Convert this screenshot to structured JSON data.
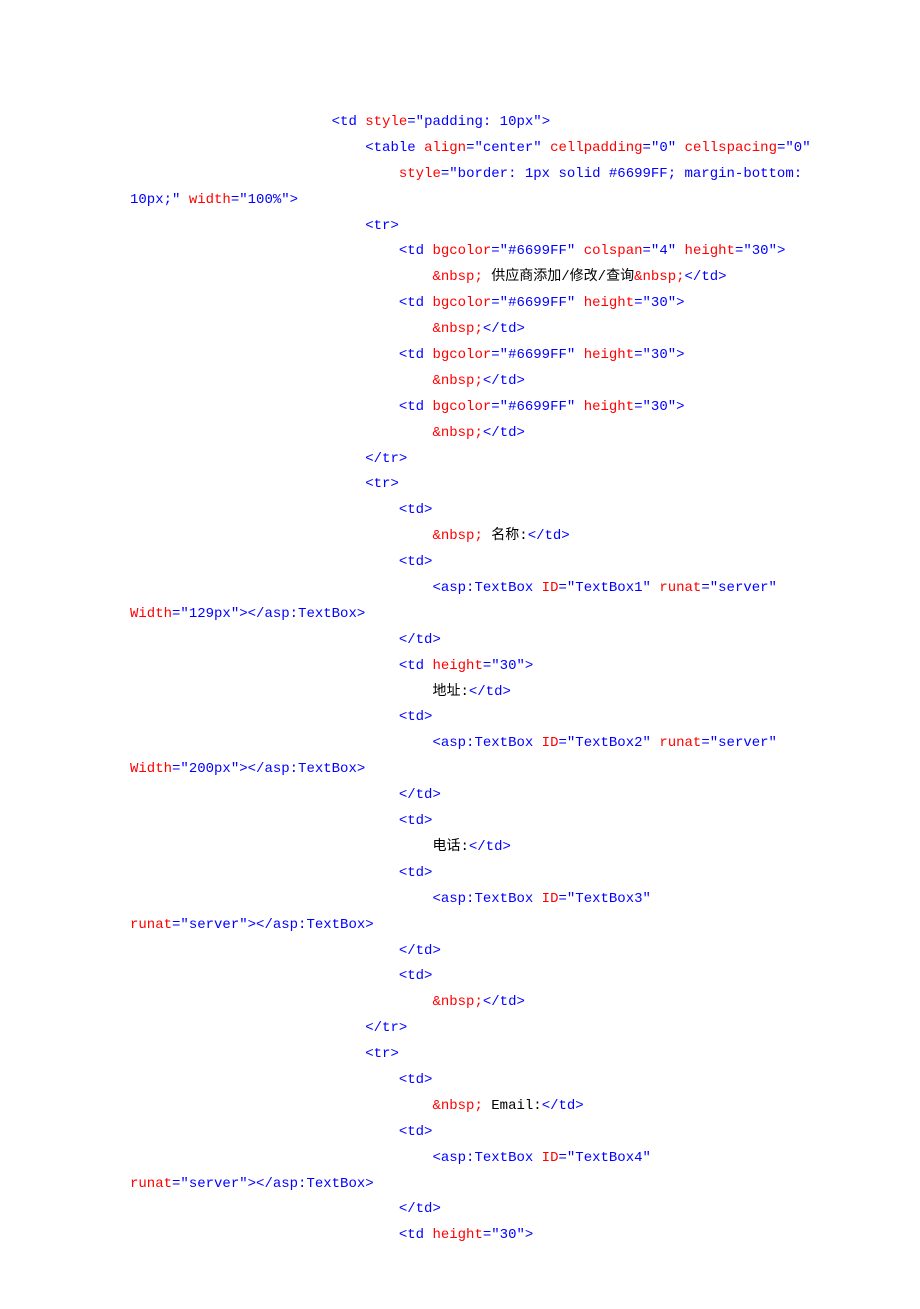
{
  "lines": [
    {
      "indent": 24,
      "parts": [
        {
          "c": "tag",
          "t": "<td "
        },
        {
          "c": "attr",
          "t": "style"
        },
        {
          "c": "tag",
          "t": "="
        },
        {
          "c": "str",
          "t": "\"padding: 10px\""
        },
        {
          "c": "tag",
          "t": ">"
        }
      ]
    },
    {
      "indent": 28,
      "parts": [
        {
          "c": "tag",
          "t": "<table "
        },
        {
          "c": "attr",
          "t": "align"
        },
        {
          "c": "tag",
          "t": "="
        },
        {
          "c": "str",
          "t": "\"center\""
        },
        {
          "c": "txt",
          "t": " "
        },
        {
          "c": "attr",
          "t": "cellpadding"
        },
        {
          "c": "tag",
          "t": "="
        },
        {
          "c": "str",
          "t": "\"0\""
        },
        {
          "c": "txt",
          "t": " "
        },
        {
          "c": "attr",
          "t": "cellspacing"
        },
        {
          "c": "tag",
          "t": "="
        },
        {
          "c": "str",
          "t": "\"0\""
        }
      ]
    },
    {
      "indent": 32,
      "parts": [
        {
          "c": "attr",
          "t": "style"
        },
        {
          "c": "tag",
          "t": "="
        },
        {
          "c": "str",
          "t": "\"border: 1px solid #6699FF; margin-bottom: "
        }
      ]
    },
    {
      "indent": 0,
      "parts": [
        {
          "c": "str",
          "t": "10px;\""
        },
        {
          "c": "txt",
          "t": " "
        },
        {
          "c": "attr",
          "t": "width"
        },
        {
          "c": "tag",
          "t": "="
        },
        {
          "c": "str",
          "t": "\"100%\""
        },
        {
          "c": "tag",
          "t": ">"
        }
      ]
    },
    {
      "indent": 28,
      "parts": [
        {
          "c": "tag",
          "t": "<tr>"
        }
      ]
    },
    {
      "indent": 32,
      "parts": [
        {
          "c": "tag",
          "t": "<td "
        },
        {
          "c": "attr",
          "t": "bgcolor"
        },
        {
          "c": "tag",
          "t": "="
        },
        {
          "c": "str",
          "t": "\"#6699FF\""
        },
        {
          "c": "txt",
          "t": " "
        },
        {
          "c": "attr",
          "t": "colspan"
        },
        {
          "c": "tag",
          "t": "="
        },
        {
          "c": "str",
          "t": "\"4\""
        },
        {
          "c": "txt",
          "t": " "
        },
        {
          "c": "attr",
          "t": "height"
        },
        {
          "c": "tag",
          "t": "="
        },
        {
          "c": "str",
          "t": "\"30\""
        },
        {
          "c": "tag",
          "t": ">"
        }
      ]
    },
    {
      "indent": 36,
      "parts": [
        {
          "c": "ent",
          "t": "&nbsp;"
        },
        {
          "c": "txt",
          "t": " 供应商添加/修改/查询"
        },
        {
          "c": "ent",
          "t": "&nbsp;"
        },
        {
          "c": "tag",
          "t": "</td>"
        }
      ]
    },
    {
      "indent": 32,
      "parts": [
        {
          "c": "tag",
          "t": "<td "
        },
        {
          "c": "attr",
          "t": "bgcolor"
        },
        {
          "c": "tag",
          "t": "="
        },
        {
          "c": "str",
          "t": "\"#6699FF\""
        },
        {
          "c": "txt",
          "t": " "
        },
        {
          "c": "attr",
          "t": "height"
        },
        {
          "c": "tag",
          "t": "="
        },
        {
          "c": "str",
          "t": "\"30\""
        },
        {
          "c": "tag",
          "t": ">"
        }
      ]
    },
    {
      "indent": 36,
      "parts": [
        {
          "c": "ent",
          "t": "&nbsp;"
        },
        {
          "c": "tag",
          "t": "</td>"
        }
      ]
    },
    {
      "indent": 32,
      "parts": [
        {
          "c": "tag",
          "t": "<td "
        },
        {
          "c": "attr",
          "t": "bgcolor"
        },
        {
          "c": "tag",
          "t": "="
        },
        {
          "c": "str",
          "t": "\"#6699FF\""
        },
        {
          "c": "txt",
          "t": " "
        },
        {
          "c": "attr",
          "t": "height"
        },
        {
          "c": "tag",
          "t": "="
        },
        {
          "c": "str",
          "t": "\"30\""
        },
        {
          "c": "tag",
          "t": ">"
        }
      ]
    },
    {
      "indent": 36,
      "parts": [
        {
          "c": "ent",
          "t": "&nbsp;"
        },
        {
          "c": "tag",
          "t": "</td>"
        }
      ]
    },
    {
      "indent": 32,
      "parts": [
        {
          "c": "tag",
          "t": "<td "
        },
        {
          "c": "attr",
          "t": "bgcolor"
        },
        {
          "c": "tag",
          "t": "="
        },
        {
          "c": "str",
          "t": "\"#6699FF\""
        },
        {
          "c": "txt",
          "t": " "
        },
        {
          "c": "attr",
          "t": "height"
        },
        {
          "c": "tag",
          "t": "="
        },
        {
          "c": "str",
          "t": "\"30\""
        },
        {
          "c": "tag",
          "t": ">"
        }
      ]
    },
    {
      "indent": 36,
      "parts": [
        {
          "c": "ent",
          "t": "&nbsp;"
        },
        {
          "c": "tag",
          "t": "</td>"
        }
      ]
    },
    {
      "indent": 28,
      "parts": [
        {
          "c": "tag",
          "t": "</tr>"
        }
      ]
    },
    {
      "indent": 28,
      "parts": [
        {
          "c": "tag",
          "t": "<tr>"
        }
      ]
    },
    {
      "indent": 32,
      "parts": [
        {
          "c": "tag",
          "t": "<td>"
        }
      ]
    },
    {
      "indent": 36,
      "parts": [
        {
          "c": "ent",
          "t": "&nbsp;"
        },
        {
          "c": "txt",
          "t": " 名称:"
        },
        {
          "c": "tag",
          "t": "</td>"
        }
      ]
    },
    {
      "indent": 32,
      "parts": [
        {
          "c": "tag",
          "t": "<td>"
        }
      ]
    },
    {
      "indent": 36,
      "parts": [
        {
          "c": "tag",
          "t": "<asp:TextBox "
        },
        {
          "c": "attr",
          "t": "ID"
        },
        {
          "c": "tag",
          "t": "="
        },
        {
          "c": "str",
          "t": "\"TextBox1\""
        },
        {
          "c": "txt",
          "t": " "
        },
        {
          "c": "attr",
          "t": "runat"
        },
        {
          "c": "tag",
          "t": "="
        },
        {
          "c": "str",
          "t": "\"server\""
        },
        {
          "c": "txt",
          "t": " "
        }
      ]
    },
    {
      "indent": 0,
      "parts": [
        {
          "c": "attr",
          "t": "Width"
        },
        {
          "c": "tag",
          "t": "="
        },
        {
          "c": "str",
          "t": "\"129px\""
        },
        {
          "c": "tag",
          "t": "></asp:TextBox>"
        }
      ]
    },
    {
      "indent": 32,
      "parts": [
        {
          "c": "tag",
          "t": "</td>"
        }
      ]
    },
    {
      "indent": 32,
      "parts": [
        {
          "c": "tag",
          "t": "<td "
        },
        {
          "c": "attr",
          "t": "height"
        },
        {
          "c": "tag",
          "t": "="
        },
        {
          "c": "str",
          "t": "\"30\""
        },
        {
          "c": "tag",
          "t": ">"
        }
      ]
    },
    {
      "indent": 36,
      "parts": [
        {
          "c": "txt",
          "t": "地址:"
        },
        {
          "c": "tag",
          "t": "</td>"
        }
      ]
    },
    {
      "indent": 32,
      "parts": [
        {
          "c": "tag",
          "t": "<td>"
        }
      ]
    },
    {
      "indent": 36,
      "parts": [
        {
          "c": "tag",
          "t": "<asp:TextBox "
        },
        {
          "c": "attr",
          "t": "ID"
        },
        {
          "c": "tag",
          "t": "="
        },
        {
          "c": "str",
          "t": "\"TextBox2\""
        },
        {
          "c": "txt",
          "t": " "
        },
        {
          "c": "attr",
          "t": "runat"
        },
        {
          "c": "tag",
          "t": "="
        },
        {
          "c": "str",
          "t": "\"server\""
        },
        {
          "c": "txt",
          "t": " "
        }
      ]
    },
    {
      "indent": 0,
      "parts": [
        {
          "c": "attr",
          "t": "Width"
        },
        {
          "c": "tag",
          "t": "="
        },
        {
          "c": "str",
          "t": "\"200px\""
        },
        {
          "c": "tag",
          "t": "></asp:TextBox>"
        }
      ]
    },
    {
      "indent": 32,
      "parts": [
        {
          "c": "tag",
          "t": "</td>"
        }
      ]
    },
    {
      "indent": 32,
      "parts": [
        {
          "c": "tag",
          "t": "<td>"
        }
      ]
    },
    {
      "indent": 36,
      "parts": [
        {
          "c": "txt",
          "t": "电话:"
        },
        {
          "c": "tag",
          "t": "</td>"
        }
      ]
    },
    {
      "indent": 32,
      "parts": [
        {
          "c": "tag",
          "t": "<td>"
        }
      ]
    },
    {
      "indent": 36,
      "parts": [
        {
          "c": "tag",
          "t": "<asp:TextBox "
        },
        {
          "c": "attr",
          "t": "ID"
        },
        {
          "c": "tag",
          "t": "="
        },
        {
          "c": "str",
          "t": "\"TextBox3\""
        },
        {
          "c": "txt",
          "t": " "
        }
      ]
    },
    {
      "indent": 0,
      "parts": [
        {
          "c": "attr",
          "t": "runat"
        },
        {
          "c": "tag",
          "t": "="
        },
        {
          "c": "str",
          "t": "\"server\""
        },
        {
          "c": "tag",
          "t": "></asp:TextBox>"
        }
      ]
    },
    {
      "indent": 32,
      "parts": [
        {
          "c": "tag",
          "t": "</td>"
        }
      ]
    },
    {
      "indent": 32,
      "parts": [
        {
          "c": "tag",
          "t": "<td>"
        }
      ]
    },
    {
      "indent": 36,
      "parts": [
        {
          "c": "ent",
          "t": "&nbsp;"
        },
        {
          "c": "tag",
          "t": "</td>"
        }
      ]
    },
    {
      "indent": 28,
      "parts": [
        {
          "c": "tag",
          "t": "</tr>"
        }
      ]
    },
    {
      "indent": 28,
      "parts": [
        {
          "c": "tag",
          "t": "<tr>"
        }
      ]
    },
    {
      "indent": 32,
      "parts": [
        {
          "c": "tag",
          "t": "<td>"
        }
      ]
    },
    {
      "indent": 36,
      "parts": [
        {
          "c": "ent",
          "t": "&nbsp;"
        },
        {
          "c": "txt",
          "t": " Email:"
        },
        {
          "c": "tag",
          "t": "</td>"
        }
      ]
    },
    {
      "indent": 32,
      "parts": [
        {
          "c": "tag",
          "t": "<td>"
        }
      ]
    },
    {
      "indent": 36,
      "parts": [
        {
          "c": "tag",
          "t": "<asp:TextBox "
        },
        {
          "c": "attr",
          "t": "ID"
        },
        {
          "c": "tag",
          "t": "="
        },
        {
          "c": "str",
          "t": "\"TextBox4\""
        },
        {
          "c": "txt",
          "t": " "
        }
      ]
    },
    {
      "indent": 0,
      "parts": [
        {
          "c": "attr",
          "t": "runat"
        },
        {
          "c": "tag",
          "t": "="
        },
        {
          "c": "str",
          "t": "\"server\""
        },
        {
          "c": "tag",
          "t": "></asp:TextBox>"
        }
      ]
    },
    {
      "indent": 32,
      "parts": [
        {
          "c": "tag",
          "t": "</td>"
        }
      ]
    },
    {
      "indent": 32,
      "parts": [
        {
          "c": "tag",
          "t": "<td "
        },
        {
          "c": "attr",
          "t": "height"
        },
        {
          "c": "tag",
          "t": "="
        },
        {
          "c": "str",
          "t": "\"30\""
        },
        {
          "c": "tag",
          "t": ">"
        }
      ]
    }
  ]
}
